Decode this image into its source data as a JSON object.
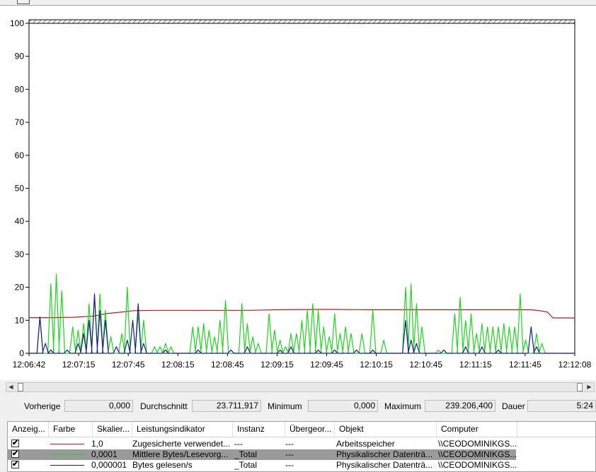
{
  "colors": {
    "memory": "#b01a1a",
    "avg_bytes": "#1fd41f",
    "bytes_read": "#1c1c8c"
  },
  "chart_data": {
    "type": "line",
    "ylim": [
      0,
      100
    ],
    "y_ticks": [
      "0",
      "10",
      "20",
      "30",
      "40",
      "50",
      "60",
      "70",
      "80",
      "90",
      "100"
    ],
    "x_ticks": [
      "12:06:42",
      "12:07:15",
      "12:07:45",
      "12:08:15",
      "12:08:45",
      "12:09:15",
      "12:09:45",
      "12:10:15",
      "12:10:45",
      "12:11:15",
      "12:11:45",
      "12:12:08"
    ],
    "grid": false,
    "series": [
      {
        "name": "Zugesicherte verwendete...",
        "color_key": "memory",
        "points": [
          [
            0,
            10.8
          ],
          [
            4,
            10.8
          ],
          [
            8,
            10.9
          ],
          [
            12,
            11.3
          ],
          [
            14,
            12.0
          ],
          [
            17,
            12.5
          ],
          [
            19,
            12.9
          ],
          [
            23,
            13.0
          ],
          [
            40,
            13.0
          ],
          [
            45,
            13.2
          ],
          [
            55,
            13.3
          ],
          [
            62,
            13.2
          ],
          [
            66,
            13.2
          ],
          [
            80,
            13.2
          ],
          [
            92,
            13.2
          ],
          [
            94,
            12.8
          ],
          [
            95,
            12.5
          ],
          [
            96,
            10.7
          ],
          [
            100,
            10.7
          ]
        ]
      },
      {
        "name": "Mittlere Bytes/Lesevorg...",
        "color_key": "avg_bytes",
        "peaks": [
          [
            2,
            11
          ],
          [
            4,
            21
          ],
          [
            5,
            24
          ],
          [
            6,
            19
          ],
          [
            8,
            8
          ],
          [
            9,
            7
          ],
          [
            10,
            9
          ],
          [
            11,
            15
          ],
          [
            12,
            17
          ],
          [
            13,
            18
          ],
          [
            14,
            13
          ],
          [
            15,
            5
          ],
          [
            17,
            6
          ],
          [
            18,
            20
          ],
          [
            20,
            12
          ],
          [
            21,
            10
          ],
          [
            23,
            2
          ],
          [
            24,
            2
          ],
          [
            25,
            3
          ],
          [
            26,
            2
          ],
          [
            30,
            8
          ],
          [
            31,
            8
          ],
          [
            32,
            9
          ],
          [
            33,
            7
          ],
          [
            34,
            5
          ],
          [
            35,
            10
          ],
          [
            36,
            16
          ],
          [
            39,
            15
          ],
          [
            40,
            9
          ],
          [
            41,
            5
          ],
          [
            42,
            3
          ],
          [
            44,
            12
          ],
          [
            45,
            7
          ],
          [
            46,
            4
          ],
          [
            47,
            2
          ],
          [
            48,
            6
          ],
          [
            49,
            6
          ],
          [
            50,
            10
          ],
          [
            51,
            13
          ],
          [
            52,
            15
          ],
          [
            53,
            13
          ],
          [
            54,
            8
          ],
          [
            55,
            5
          ],
          [
            56,
            12
          ],
          [
            57,
            6
          ],
          [
            58,
            8
          ],
          [
            59,
            6
          ],
          [
            61,
            6
          ],
          [
            63,
            13
          ],
          [
            65,
            4
          ],
          [
            69,
            20
          ],
          [
            70,
            21
          ],
          [
            71,
            15
          ],
          [
            72,
            8
          ],
          [
            75,
            1
          ],
          [
            78,
            12
          ],
          [
            79,
            17
          ],
          [
            80,
            10
          ],
          [
            81,
            12
          ],
          [
            82,
            6
          ],
          [
            83,
            9
          ],
          [
            84,
            8
          ],
          [
            85,
            8
          ],
          [
            86,
            8
          ],
          [
            87,
            9
          ],
          [
            88,
            8
          ],
          [
            89,
            8
          ],
          [
            90,
            18
          ],
          [
            91,
            4
          ],
          [
            93,
            6
          ],
          [
            94,
            3
          ]
        ]
      },
      {
        "name": "Bytes gelesen/s",
        "color_key": "bytes_read",
        "peaks": [
          [
            2,
            11
          ],
          [
            3,
            3
          ],
          [
            4,
            1
          ],
          [
            7,
            1
          ],
          [
            9,
            3
          ],
          [
            10,
            6
          ],
          [
            11,
            10
          ],
          [
            12,
            18
          ],
          [
            13,
            13
          ],
          [
            14,
            10
          ],
          [
            16,
            2
          ],
          [
            18,
            4
          ],
          [
            19,
            10
          ],
          [
            20,
            15
          ],
          [
            21,
            3
          ],
          [
            25,
            1
          ],
          [
            31,
            1
          ],
          [
            37,
            1
          ],
          [
            40,
            2
          ],
          [
            46,
            1
          ],
          [
            48,
            2
          ],
          [
            53,
            1
          ],
          [
            56,
            1
          ],
          [
            60,
            1
          ],
          [
            63,
            1
          ],
          [
            69,
            10
          ],
          [
            70,
            4
          ],
          [
            71,
            3
          ],
          [
            76,
            1
          ],
          [
            80,
            2
          ],
          [
            83,
            2
          ],
          [
            86,
            1
          ],
          [
            92,
            8
          ],
          [
            93,
            2
          ]
        ]
      }
    ]
  },
  "scrollbar": {
    "left_arrow": "◀",
    "right_arrow": "▶"
  },
  "stats": {
    "prev_label": "Vorherige",
    "prev_value": "0,000",
    "avg_label": "Durchschnitt",
    "avg_value": "23.711,917",
    "min_label": "Minimum",
    "min_value": "0,000",
    "max_label": "Maximum",
    "max_value": "239.206,400",
    "dur_label": "Dauer",
    "dur_value": "5:24"
  },
  "legend": {
    "headers": [
      "Anzeig...",
      "Farbe",
      "Skalier...",
      "Leistungsindikator",
      "Instanz",
      "Übergeor...",
      "Objekt",
      "Computer"
    ],
    "rows": [
      {
        "check": "✔",
        "scale": "1,0",
        "counter": "Zugesicherte verwendet...",
        "instance": "---",
        "parent": "---",
        "object": "Arbeitsspeicher",
        "computer": "\\\\CEODOMINIKGS..."
      },
      {
        "check": "✔",
        "scale": "0,0001",
        "counter": "Mittlere Bytes/Lesevorg...",
        "instance": "_Total",
        "parent": "---",
        "object": "Physikalischer Datenträ...",
        "computer": "\\\\CEODOMINIKGS..."
      },
      {
        "check": "✔",
        "scale": "0,000001",
        "counter": "Bytes gelesen/s",
        "instance": "_Total",
        "parent": "---",
        "object": "Physikalischer Datenträ...",
        "computer": "\\\\CEODOMINIKGS..."
      }
    ]
  }
}
